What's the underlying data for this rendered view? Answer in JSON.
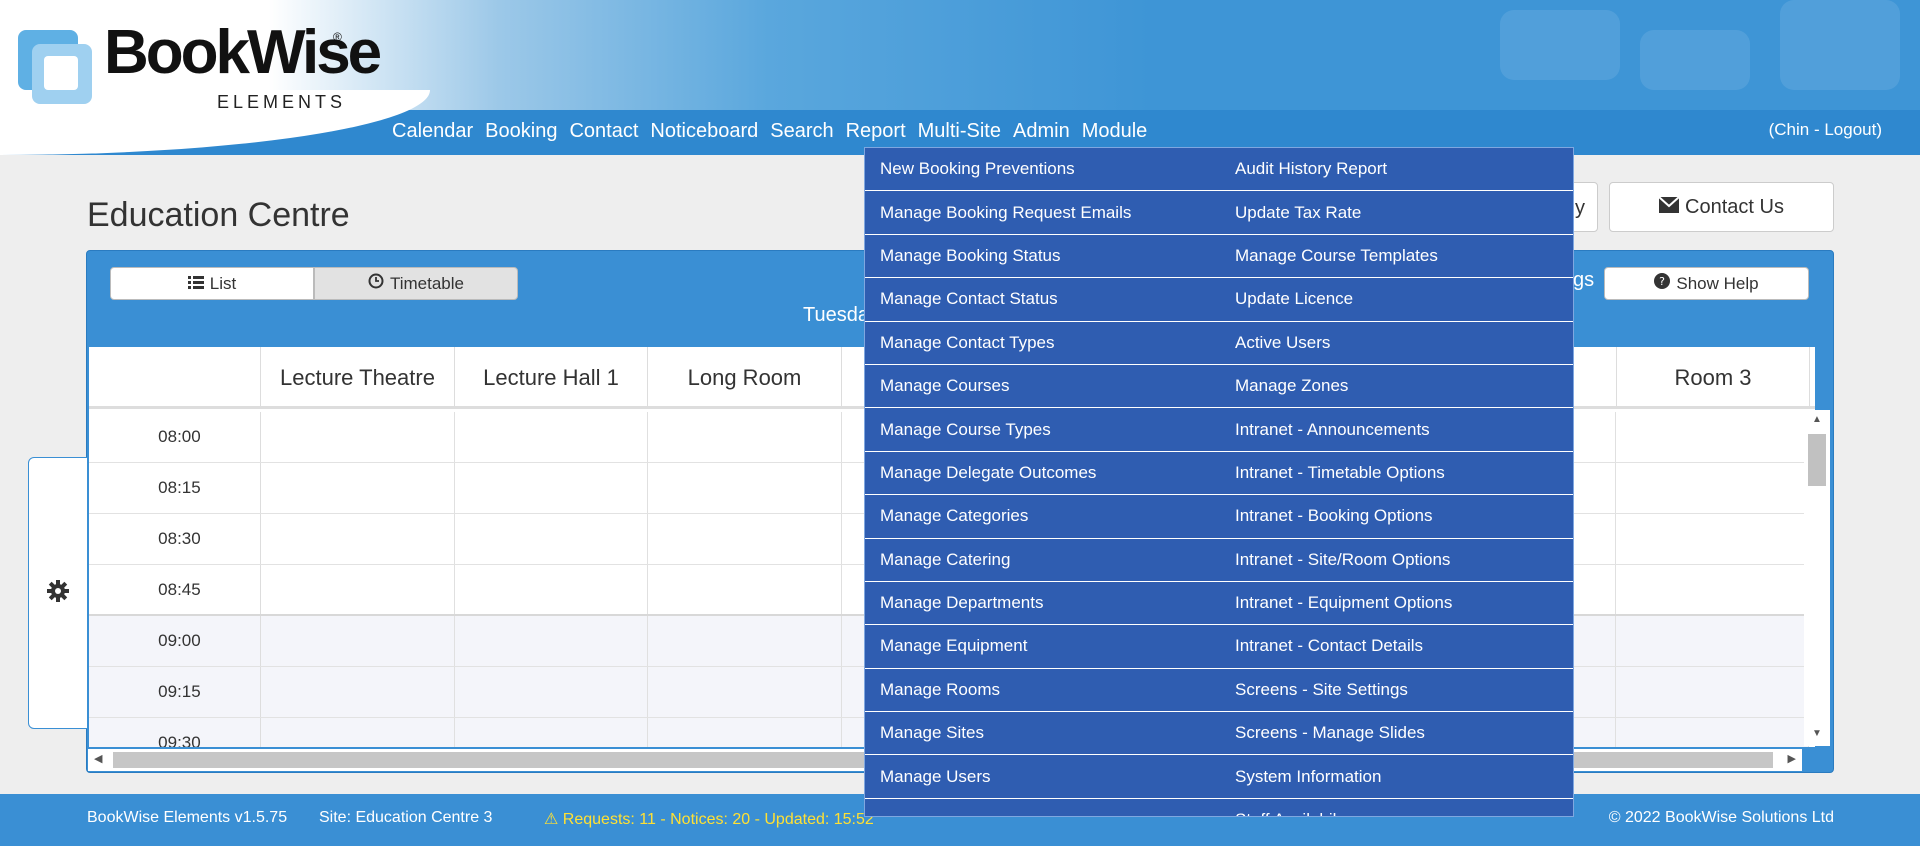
{
  "brand": {
    "name": "BookWise",
    "sub": "ELEMENTS",
    "reg": "®"
  },
  "nav": [
    "Calendar",
    "Booking",
    "Contact",
    "Noticeboard",
    "Search",
    "Report",
    "Multi-Site",
    "Admin",
    "Module"
  ],
  "user": {
    "logout": "(Chin - Logout)"
  },
  "page": {
    "title": "Education Centre",
    "partial_button": "y",
    "contact_button": "Contact Us"
  },
  "toolbar": {
    "list_label": "List",
    "timetable_label": "Timetable",
    "date_partial": "Tuesda",
    "settings_partial": "gs",
    "help_label": "Show Help"
  },
  "rooms": [
    "Lecture Theatre",
    "Lecture Hall 1",
    "Long Room",
    "Room 3"
  ],
  "times": [
    "08:00",
    "08:15",
    "08:30",
    "08:45",
    "09:00",
    "09:15",
    "09:30"
  ],
  "admin_menu": {
    "left": [
      "New Booking Preventions",
      "Manage Booking Request Emails",
      "Manage Booking Status",
      "Manage Contact Status",
      "Manage Contact Types",
      "Manage Courses",
      "Manage Course Types",
      "Manage Delegate Outcomes",
      "Manage Categories",
      "Manage Catering",
      "Manage Departments",
      "Manage Equipment",
      "Manage Rooms",
      "Manage Sites",
      "Manage Users"
    ],
    "right": [
      "Audit History Report",
      "Update Tax Rate",
      "Manage Course Templates",
      "Update Licence",
      "Active Users",
      "Manage Zones",
      "Intranet - Announcements",
      "Intranet - Timetable Options",
      "Intranet - Booking Options",
      "Intranet - Site/Room Options",
      "Intranet - Equipment Options",
      "Intranet - Contact Details",
      "Screens - Site Settings",
      "Screens - Manage Slides",
      "System Information",
      "Staff Availabil"
    ]
  },
  "footer": {
    "version": "BookWise Elements v1.5.75",
    "site": "Site: Education Centre 3",
    "status": "Requests: 11 - Notices: 20 - Updated: 15:52",
    "copyright": "© 2022 BookWise Solutions Ltd"
  },
  "colors": {
    "header_blue": "#3a8fd4",
    "menu_blue": "#2f5db1",
    "status_yellow": "#ffe033"
  },
  "icons": [
    "list-icon",
    "clock-icon",
    "envelope-icon",
    "question-icon",
    "gear-icon",
    "warning-icon"
  ]
}
